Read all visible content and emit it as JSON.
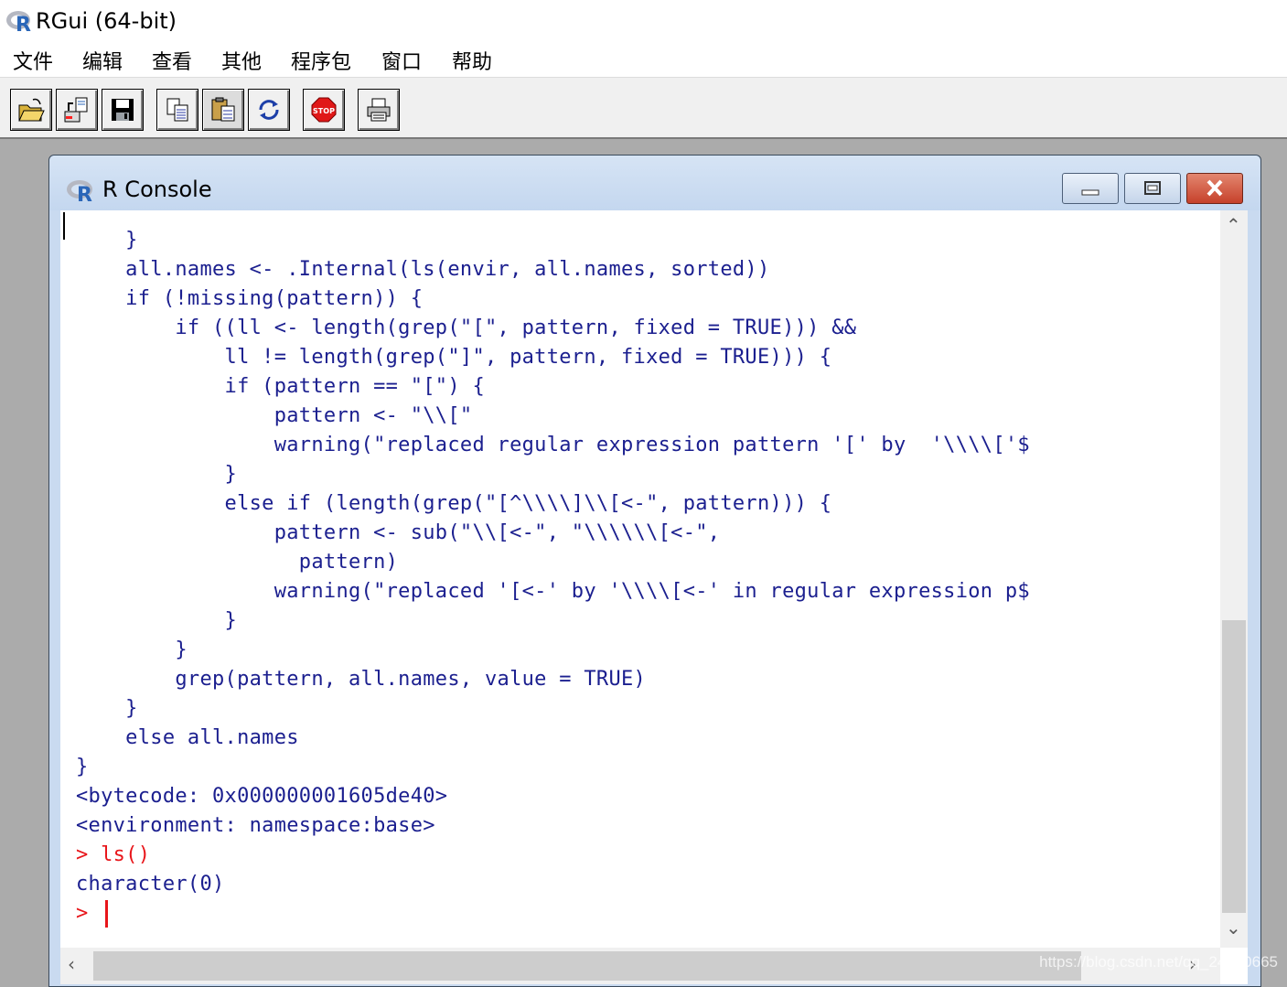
{
  "app": {
    "title": "RGui (64-bit)"
  },
  "menu": [
    "文件",
    "编辑",
    "查看",
    "其他",
    "程序包",
    "窗口",
    "帮助"
  ],
  "toolbar": {
    "buttons": [
      "open-script",
      "load-workspace",
      "save-workspace",
      "copy",
      "paste",
      "copy-and-paste",
      "stop",
      "print"
    ]
  },
  "console": {
    "title": "R Console",
    "lines": [
      "    }",
      "    all.names <- .Internal(ls(envir, all.names, sorted))",
      "    if (!missing(pattern)) {",
      "        if ((ll <- length(grep(\"[\", pattern, fixed = TRUE))) &&",
      "            ll != length(grep(\"]\", pattern, fixed = TRUE))) {",
      "            if (pattern == \"[\") {",
      "                pattern <- \"\\\\[\"",
      "                warning(\"replaced regular expression pattern '[' by  '\\\\\\\\['$",
      "            }",
      "            else if (length(grep(\"[^\\\\\\\\]\\\\[<-\", pattern))) {",
      "                pattern <- sub(\"\\\\[<-\", \"\\\\\\\\\\\\[<-\",",
      "                  pattern)",
      "                warning(\"replaced '[<-' by '\\\\\\\\[<-' in regular expression p$",
      "            }",
      "        }",
      "        grep(pattern, all.names, value = TRUE)",
      "    }",
      "    else all.names",
      "}",
      "<bytecode: 0x000000001605de40>",
      "<environment: namespace:base>",
      "> ls()",
      "character(0)",
      "> "
    ],
    "prompt_lines": [
      21,
      23
    ]
  },
  "watermark": "https://blog.csdn.net/qq_24530665",
  "colors": {
    "output": "#1b1f8f",
    "input": "#e8151a",
    "window_frame": "#c9daf0",
    "close_button": "#c6412b"
  }
}
